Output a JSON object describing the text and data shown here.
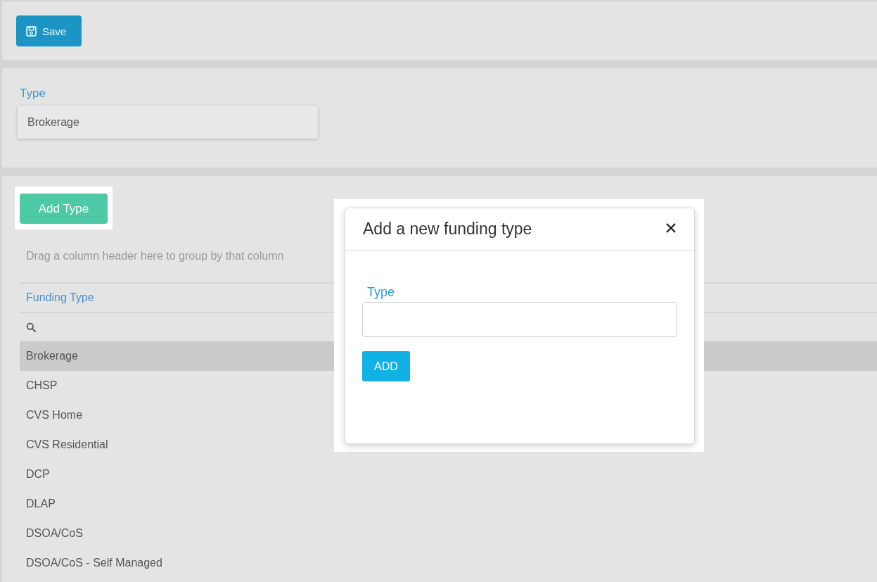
{
  "toolbar": {
    "save_button": {
      "label": "Save"
    }
  },
  "type_panel": {
    "label": "Type",
    "value": "Brokerage"
  },
  "grid_panel": {
    "add_button": {
      "label": "Add Type"
    },
    "group_hint": "Drag a column header here to group by that column",
    "columns": [
      "Funding Type"
    ],
    "rows": [
      {
        "cells": [
          "Brokerage"
        ],
        "selected": true
      },
      {
        "cells": [
          "CHSP"
        ],
        "selected": false
      },
      {
        "cells": [
          "CVS Home"
        ],
        "selected": false
      },
      {
        "cells": [
          "CVS Residential"
        ],
        "selected": false
      },
      {
        "cells": [
          "DCP"
        ],
        "selected": false
      },
      {
        "cells": [
          "DLAP"
        ],
        "selected": false
      },
      {
        "cells": [
          "DSOA/CoS"
        ],
        "selected": false
      },
      {
        "cells": [
          "DSOA/CoS - Self Managed"
        ],
        "selected": false
      }
    ]
  },
  "dialog": {
    "title": "Add a new funding type",
    "field": {
      "label": "Type"
    },
    "submit_button": {
      "label": "ADD"
    }
  }
}
